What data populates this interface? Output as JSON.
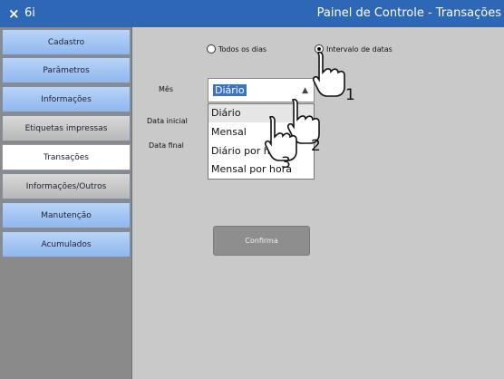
{
  "titlebar": {
    "close_icon": "×",
    "app_name": "6i",
    "title": "Painel de Controle - Transações"
  },
  "sidebar": {
    "items": [
      {
        "label": "Cadastro",
        "style": "blue"
      },
      {
        "label": "Parâmetros",
        "style": "blue"
      },
      {
        "label": "Informações",
        "style": "blue"
      },
      {
        "label": "Etiquetas impressas",
        "style": "gray"
      },
      {
        "label": "Transações",
        "style": "active"
      },
      {
        "label": "Informações/Outros",
        "style": "gray"
      },
      {
        "label": "Manutenção",
        "style": "blue"
      },
      {
        "label": "Acumulados",
        "style": "blue"
      }
    ]
  },
  "filters": {
    "all_days_label": "Todos os dias",
    "date_range_label": "Intervalo de datas",
    "selected": "Intervalo de datas"
  },
  "form": {
    "month_label": "Mês",
    "start_date_label": "Data inicial",
    "end_date_label": "Data final",
    "month_select_value": "Diário",
    "options": [
      "Diário",
      "Mensal",
      "Diário por hora",
      "Mensal por hora"
    ],
    "highlighted_option": "Diário"
  },
  "confirm_button": "Confirma",
  "annotations": {
    "step1": "1",
    "step2": "2",
    "step3": "3"
  },
  "colors": {
    "titlebar": "#2d67b5",
    "nav_blue": "#9cc3f3",
    "nav_gray": "#c8c8c8",
    "content_bg": "#c9c9c9",
    "selection": "#3b73c8"
  }
}
